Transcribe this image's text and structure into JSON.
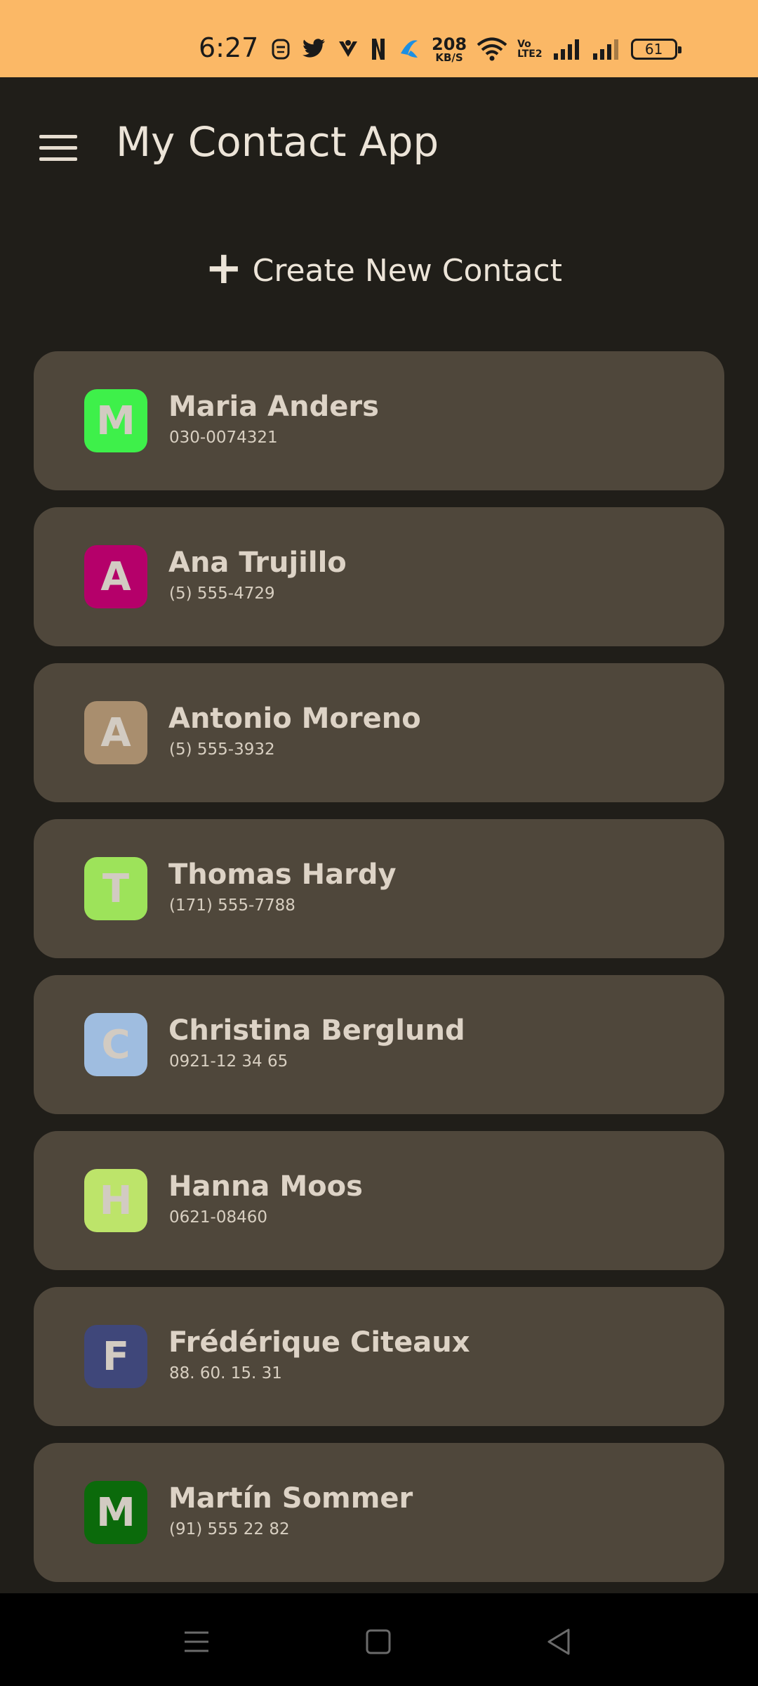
{
  "status_bar": {
    "time": "6:27",
    "net_speed_value": "208",
    "net_speed_unit": "KB/S",
    "volte_top": "Vo",
    "volte_bottom": "LTE2",
    "battery": "61",
    "icons": [
      "face-icon",
      "twitter-icon",
      "app-icon",
      "netflix-icon",
      "telenor-icon",
      "wifi-icon",
      "volte-icon",
      "signal-icon",
      "signal-icon",
      "battery-icon"
    ]
  },
  "app_bar": {
    "title": "My Contact App",
    "menu_icon": "hamburger-icon"
  },
  "create_button": {
    "icon": "plus-icon",
    "label": "Create New Contact"
  },
  "contacts": [
    {
      "initial": "M",
      "name": "Maria Anders",
      "phone": "030-0074321",
      "color": "#3ef04a"
    },
    {
      "initial": "A",
      "name": "Ana Trujillo",
      "phone": "(5) 555-4729",
      "color": "#b5006a"
    },
    {
      "initial": "A",
      "name": "Antonio Moreno",
      "phone": "(5) 555-3932",
      "color": "#a98e6e"
    },
    {
      "initial": "T",
      "name": "Thomas Hardy",
      "phone": "(171) 555-7788",
      "color": "#9de35a"
    },
    {
      "initial": "C",
      "name": "Christina Berglund",
      "phone": "0921-12 34 65",
      "color": "#9fbde0"
    },
    {
      "initial": "H",
      "name": "Hanna Moos",
      "phone": "0621-08460",
      "color": "#bde46a"
    },
    {
      "initial": "F",
      "name": "Frédérique Citeaux",
      "phone": "88. 60. 15. 31",
      "color": "#3f477a"
    },
    {
      "initial": "M",
      "name": "Martín Sommer",
      "phone": "(91) 555 22 82",
      "color": "#0b6a0b"
    }
  ],
  "nav_bar": {
    "icons": [
      "recent-apps-icon",
      "home-icon",
      "back-icon"
    ]
  }
}
